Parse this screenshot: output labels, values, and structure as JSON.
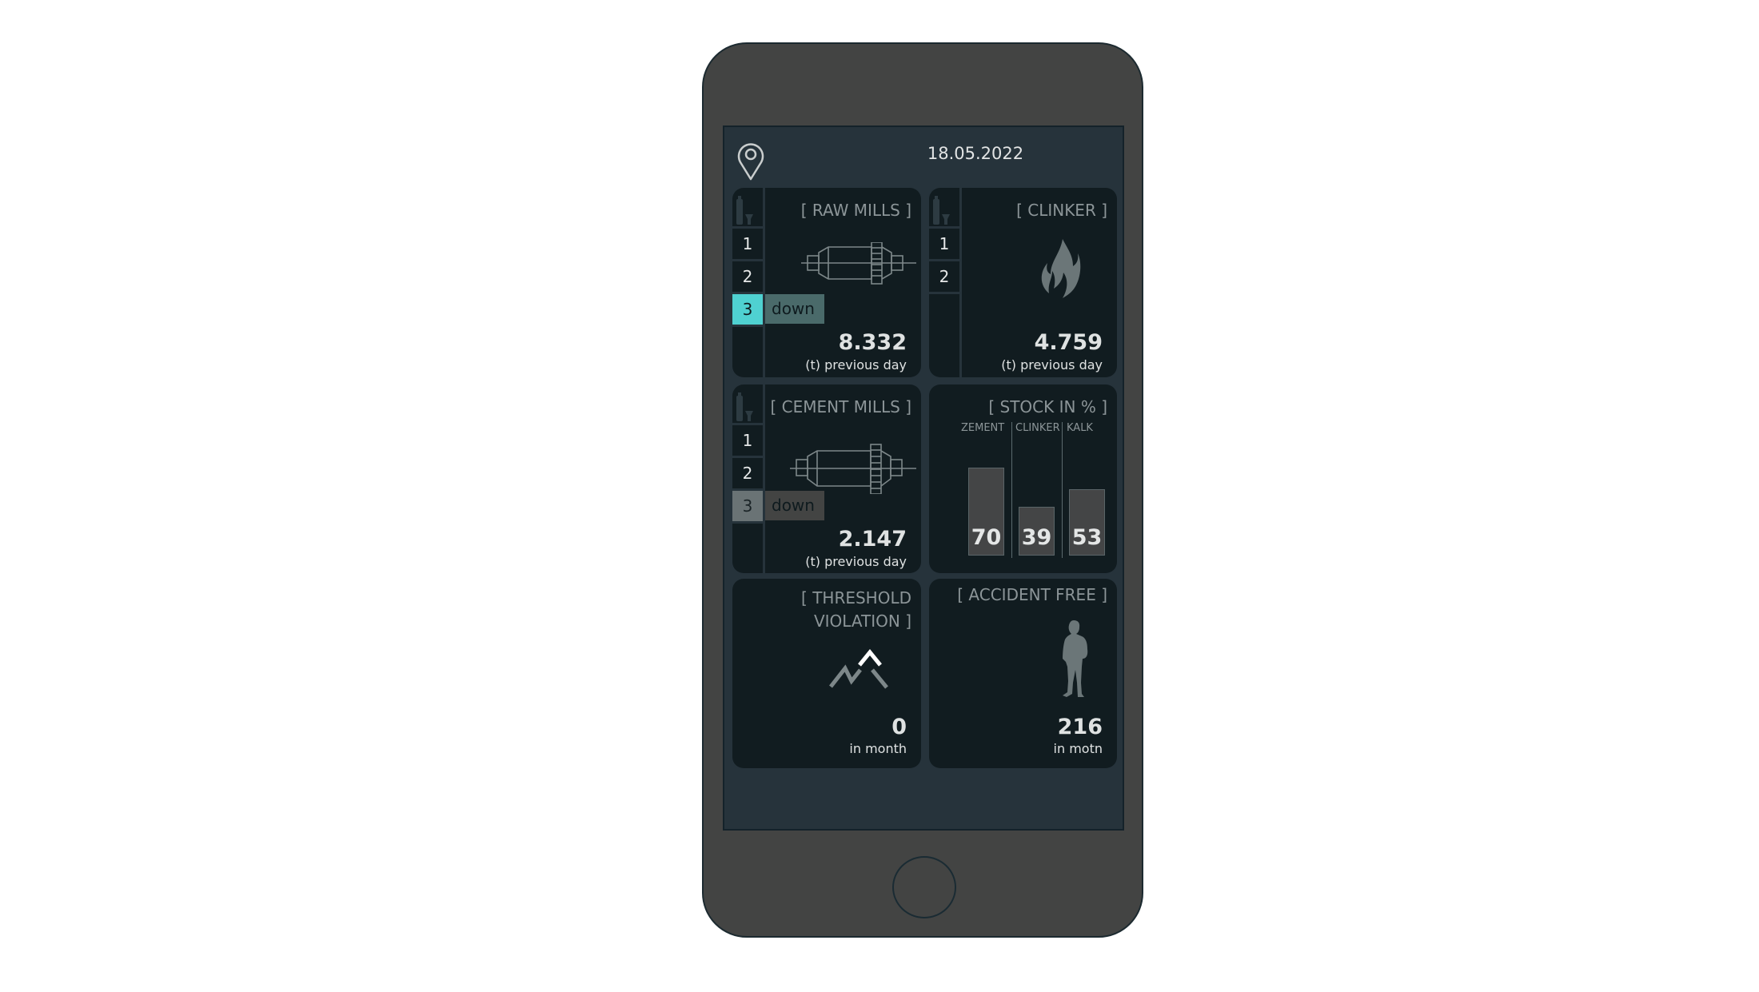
{
  "header": {
    "location_icon": "map-pin-icon",
    "date": "18.05.2022"
  },
  "cards": {
    "raw_mills": {
      "title": "[ RAW MILLS ]",
      "icon": "mill-icon",
      "strip_icon": "silo-icon",
      "units": [
        "1",
        "2",
        "3"
      ],
      "down_unit": "3",
      "down_label": "down",
      "value": "8.332",
      "subtitle": "(t) previous day",
      "accent": "#4fd1d1"
    },
    "clinker": {
      "title": "[ CLINKER ]",
      "icon": "flame-icon",
      "strip_icon": "silo-icon",
      "units": [
        "1",
        "2"
      ],
      "value": "4.759",
      "subtitle": "(t) previous day"
    },
    "cement_mills": {
      "title": "[ CEMENT MILLS ]",
      "icon": "mill-icon",
      "strip_icon": "silo-icon",
      "units": [
        "1",
        "2",
        "3"
      ],
      "down_unit": "3",
      "down_label": "down",
      "value": "2.147",
      "subtitle": "(t) previous day"
    },
    "stock": {
      "title": "[ STOCK IN % ]"
    },
    "threshold": {
      "title_line1": "[ THRESHOLD",
      "title_line2": "VIOLATION ]",
      "icon": "mountain-peak-icon",
      "value": "0",
      "subtitle": "in month"
    },
    "accident_free": {
      "title": "[ ACCIDENT FREE ]",
      "icon": "worker-silhouette-icon",
      "value": "216",
      "subtitle": "in motn"
    }
  },
  "chart_data": {
    "type": "bar",
    "title": "[ STOCK IN % ]",
    "categories": [
      "ZEMENT",
      "CLINKER",
      "KALK"
    ],
    "values": [
      70,
      39,
      53
    ],
    "xlabel": "",
    "ylabel": "",
    "ylim": [
      0,
      100
    ],
    "grid": false,
    "legend": "none"
  }
}
